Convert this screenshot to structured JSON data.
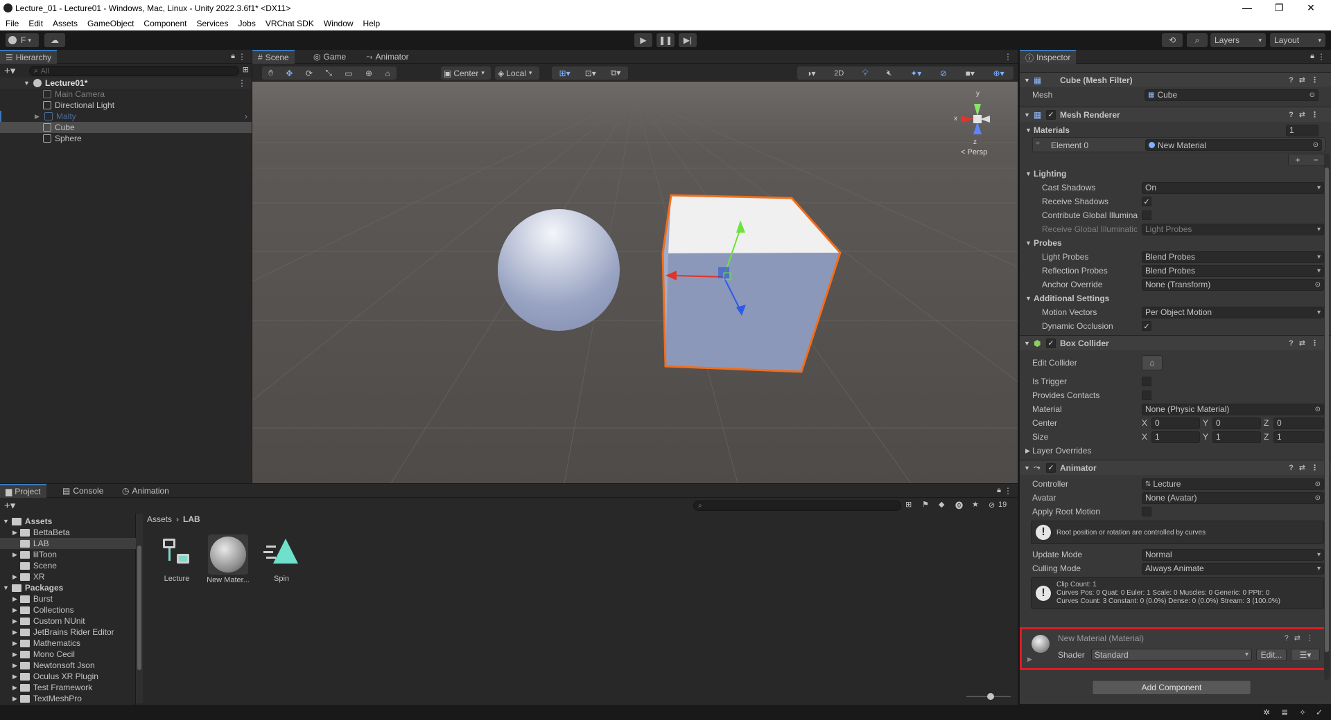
{
  "window": {
    "title": "Lecture_01 - Lecture01 - Windows, Mac, Linux - Unity 2022.3.6f1* <DX11>",
    "minimize": "—",
    "maximize": "❐",
    "close": "✕"
  },
  "menu": [
    "File",
    "Edit",
    "Assets",
    "GameObject",
    "Component",
    "Services",
    "Jobs",
    "VRChat SDK",
    "Window",
    "Help"
  ],
  "toolbar": {
    "account_label": "F",
    "layers_label": "Layers",
    "layout_label": "Layout"
  },
  "hierarchy": {
    "tab": "Hierarchy",
    "search_placeholder": "All",
    "scene": "Lecture01*",
    "items": [
      "Main Camera",
      "Directional Light",
      "Malty",
      "Cube",
      "Sphere"
    ]
  },
  "scene": {
    "tabs": [
      "Scene",
      "Game",
      "Animator"
    ],
    "pivot": "Center",
    "space": "Local",
    "mode_2d": "2D",
    "persp": "< Persp",
    "gizmo_axes": {
      "y": "y",
      "x": "x",
      "z": "z"
    }
  },
  "inspector": {
    "tab": "Inspector",
    "mesh_filter": {
      "title": "Cube (Mesh Filter)",
      "mesh_label": "Mesh",
      "mesh_value": "Cube"
    },
    "mesh_renderer": {
      "title": "Mesh Renderer",
      "materials_label": "Materials",
      "materials_count": "1",
      "element_label": "Element 0",
      "element_value": "New Material",
      "add": "+",
      "remove": "−",
      "lighting": "Lighting",
      "cast_shadows_label": "Cast Shadows",
      "cast_shadows_value": "On",
      "receive_shadows_label": "Receive Shadows",
      "contribute_gi_label": "Contribute Global Illumina",
      "receive_gi_label": "Receive Global Illuminatic",
      "receive_gi_value": "Light Probes",
      "probes": "Probes",
      "light_probes_label": "Light Probes",
      "light_probes_value": "Blend Probes",
      "reflection_probes_label": "Reflection Probes",
      "reflection_probes_value": "Blend Probes",
      "anchor_override_label": "Anchor Override",
      "anchor_override_value": "None (Transform)",
      "additional_settings": "Additional Settings",
      "motion_vectors_label": "Motion Vectors",
      "motion_vectors_value": "Per Object Motion",
      "dynamic_occlusion_label": "Dynamic Occlusion"
    },
    "box_collider": {
      "title": "Box Collider",
      "edit_collider_label": "Edit Collider",
      "is_trigger_label": "Is Trigger",
      "provides_contacts_label": "Provides Contacts",
      "material_label": "Material",
      "material_value": "None (Physic Material)",
      "center_label": "Center",
      "center": {
        "x": "0",
        "y": "0",
        "z": "0"
      },
      "size_label": "Size",
      "size": {
        "x": "1",
        "y": "1",
        "z": "1"
      },
      "axis_x": "X",
      "axis_y": "Y",
      "axis_z": "Z",
      "layer_overrides": "Layer Overrides"
    },
    "animator": {
      "title": "Animator",
      "controller_label": "Controller",
      "controller_value": "Lecture",
      "avatar_label": "Avatar",
      "avatar_value": "None (Avatar)",
      "apply_root_motion_label": "Apply Root Motion",
      "root_help": "Root position or rotation are controlled by curves",
      "update_mode_label": "Update Mode",
      "update_mode_value": "Normal",
      "culling_mode_label": "Culling Mode",
      "culling_mode_value": "Always Animate",
      "clip_info": [
        "Clip Count: 1",
        "Curves Pos: 0 Quat: 0 Euler: 1 Scale: 0 Muscles: 0 Generic: 0 PPtr: 0",
        "Curves Count: 3 Constant: 0 (0.0%) Dense: 0 (0.0%) Stream: 3 (100.0%)"
      ]
    },
    "material": {
      "title": "New Material (Material)",
      "shader_label": "Shader",
      "shader_value": "Standard",
      "edit_button": "Edit..."
    },
    "add_component": "Add Component"
  },
  "project": {
    "tabs": [
      "Project",
      "Console",
      "Animation"
    ],
    "hidden_count": "19",
    "breadcrumb": [
      "Assets",
      "LAB"
    ],
    "tree": {
      "assets_label": "Assets",
      "assets": [
        "BettaBeta",
        "LAB",
        "lilToon",
        "Scene",
        "XR"
      ],
      "packages_label": "Packages",
      "packages": [
        "Burst",
        "Collections",
        "Custom NUnit",
        "JetBrains Rider Editor",
        "Mathematics",
        "Mono Cecil",
        "Newtonsoft Json",
        "Oculus XR Plugin",
        "Test Framework",
        "TextMeshPro"
      ]
    },
    "assets_grid": [
      "Lecture",
      "New Mater...",
      "Spin"
    ]
  },
  "colors": {
    "accent": "#3a79bb",
    "selection_outline": "#f26e1d",
    "highlight_box": "#e01b24"
  }
}
